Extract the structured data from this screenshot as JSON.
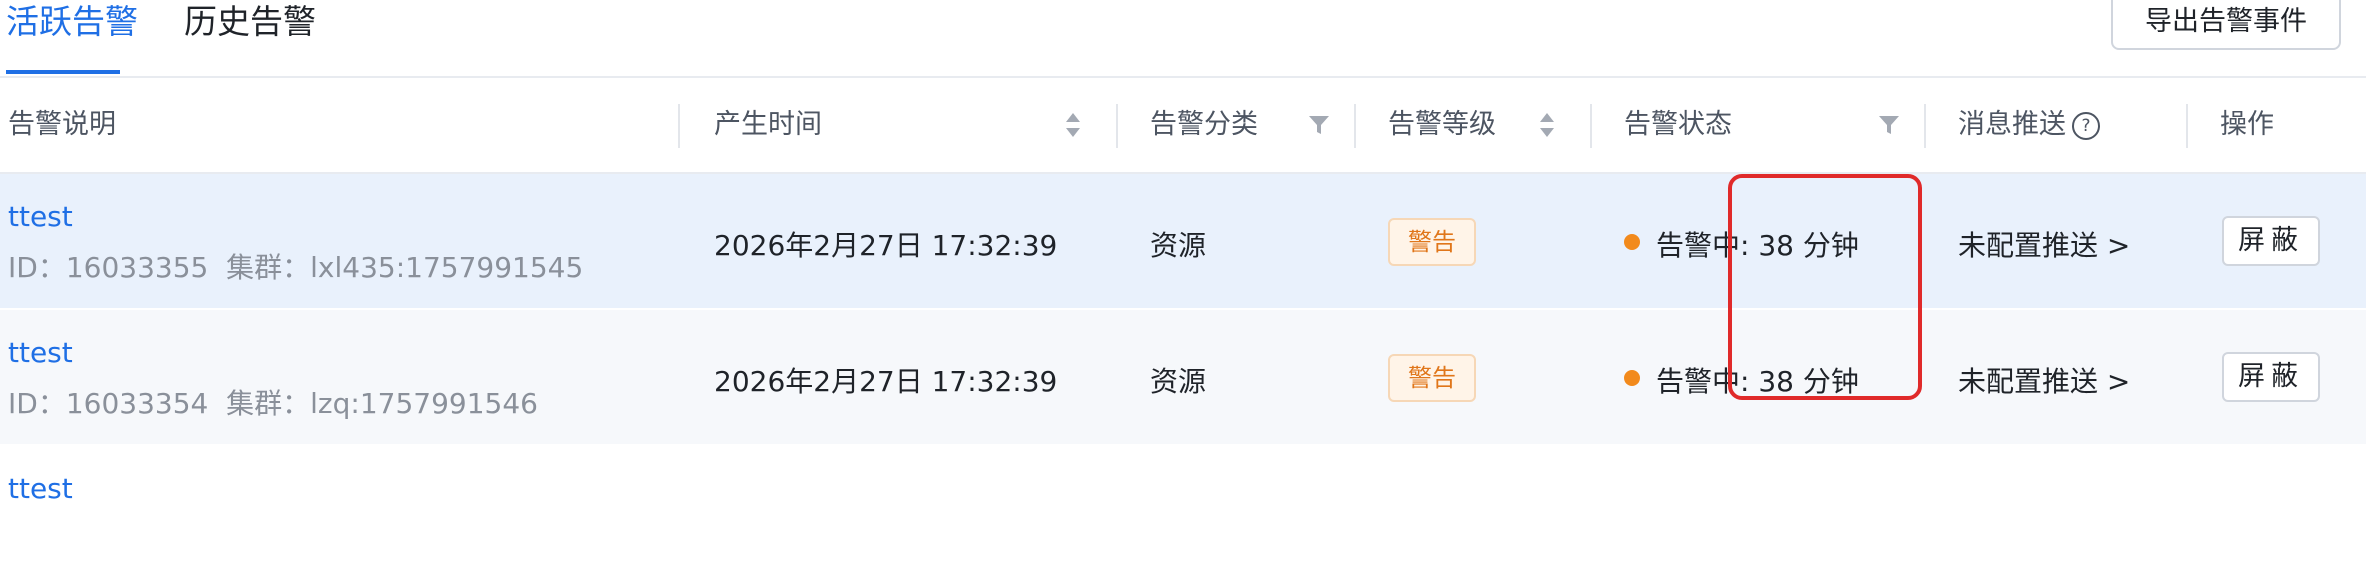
{
  "tabs": {
    "active_label": "活跃告警",
    "history_label": "历史告警",
    "export_label": "导出告警事件"
  },
  "table": {
    "headers": {
      "desc": "告警说明",
      "time": "产生时间",
      "category": "告警分类",
      "level": "告警等级",
      "status": "告警状态",
      "push": "消息推送",
      "action": "操作"
    },
    "rows": [
      {
        "name": "ttest",
        "meta": "ID：16033355  集群：lxl435:1757991545",
        "time": "2026年2月27日 17:32:39",
        "category": "资源",
        "level": "警告",
        "status": "告警中: 38 分钟",
        "push": "未配置推送 >",
        "action": "屏蔽"
      },
      {
        "name": "ttest",
        "meta": "ID：16033354  集群：lzq:1757991546",
        "time": "2026年2月27日 17:32:39",
        "category": "资源",
        "level": "警告",
        "status": "告警中: 38 分钟",
        "push": "未配置推送 >",
        "action": "屏蔽"
      }
    ],
    "partial_row_name": "ttest"
  },
  "colors": {
    "accent": "#1f6fe5",
    "row_selected": "#e9f1fc",
    "status_dot": "#f28a1c",
    "badge_text": "#e0761a",
    "highlight_box": "#e02a2a"
  }
}
